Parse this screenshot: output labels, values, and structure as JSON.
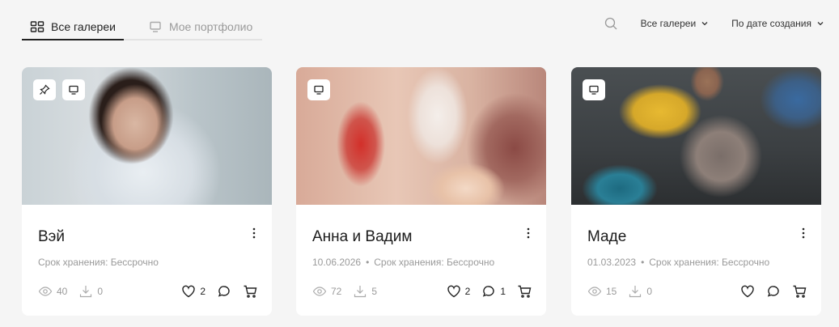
{
  "tabs": [
    {
      "label": "Все галереи",
      "active": true,
      "icon": "grid-icon"
    },
    {
      "label": "Мое портфолио",
      "active": false,
      "icon": "monitor-icon"
    }
  ],
  "toolbar": {
    "filter_label": "Все галереи",
    "sort_label": "По дате создания"
  },
  "cards": [
    {
      "title": "Вэй",
      "date": "",
      "storage": "Срок хранения: Бессрочно",
      "views": "40",
      "downloads": "0",
      "likes": "2",
      "comments": "",
      "pinned": true
    },
    {
      "title": "Анна и Вадим",
      "date": "10.06.2026",
      "storage": "Срок хранения: Бессрочно",
      "views": "72",
      "downloads": "5",
      "likes": "2",
      "comments": "1",
      "pinned": false
    },
    {
      "title": "Маде",
      "date": "01.03.2023",
      "storage": "Срок хранения: Бессрочно",
      "views": "15",
      "downloads": "0",
      "likes": "",
      "comments": "",
      "pinned": false
    }
  ],
  "colors": {
    "background": "#f5f5f5",
    "text": "#222222",
    "muted": "#9a9a9a"
  }
}
